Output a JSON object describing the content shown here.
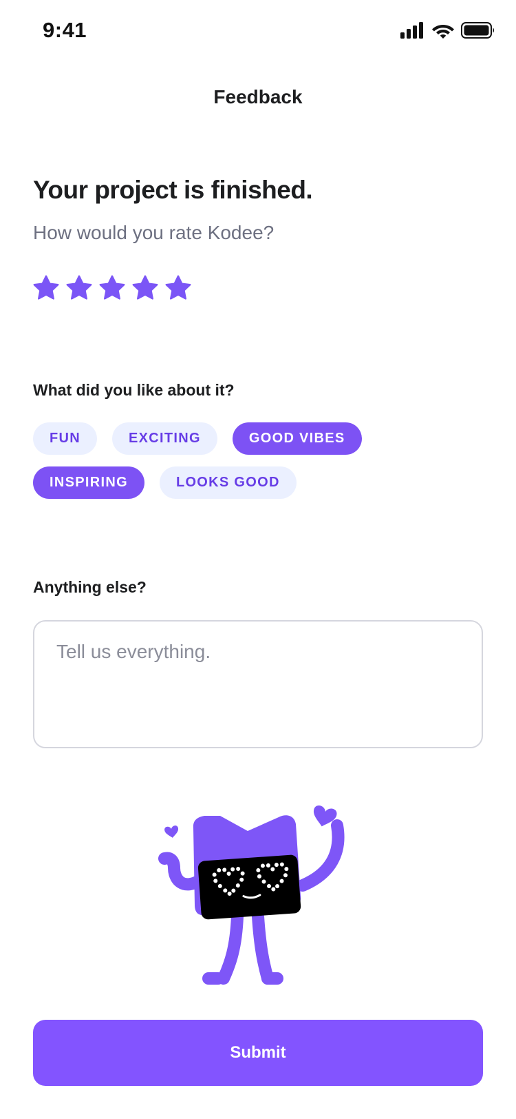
{
  "status_bar": {
    "time": "9:41",
    "icons": [
      "cellular-signal-icon",
      "wifi-icon",
      "battery-icon"
    ]
  },
  "header": {
    "title": "Feedback"
  },
  "main": {
    "headline": "Your project is finished.",
    "rating_prompt": "How would you rate Kodee?",
    "rating": {
      "value": 5,
      "max": 5
    },
    "likes": {
      "label": "What did you like about it?",
      "options": [
        {
          "label": "FUN",
          "selected": false
        },
        {
          "label": "EXCITING",
          "selected": false
        },
        {
          "label": "GOOD VIBES",
          "selected": true
        },
        {
          "label": "INSPIRING",
          "selected": true
        },
        {
          "label": "LOOKS GOOD",
          "selected": false
        }
      ]
    },
    "comment": {
      "label": "Anything else?",
      "value": "",
      "placeholder": "Tell us everything."
    },
    "illustration": "kodee-mascot-heart-eyes"
  },
  "footer": {
    "submit_label": "Submit"
  },
  "colors": {
    "accent": "#8354ff",
    "chip_bg": "#ebf0ff",
    "chip_text": "#673de6",
    "text_primary": "#1d1e20",
    "text_secondary": "#6d7081"
  }
}
